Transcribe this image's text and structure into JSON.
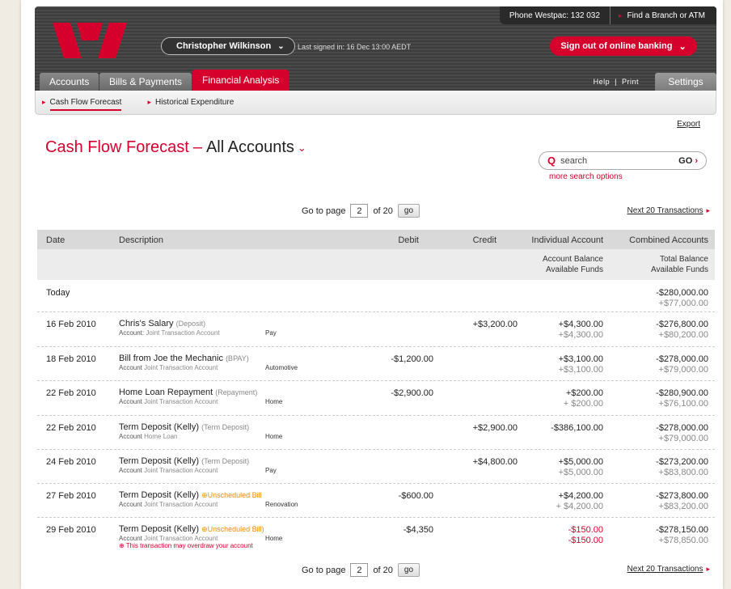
{
  "header": {
    "phone": "Phone Westpac:  132 032",
    "find_branch": "Find a Branch or ATM",
    "user_name": "Christopher Wilkinson",
    "last_signed": "Last signed in: 16 Dec 13:00 AEDT",
    "sign_out": "Sign out of online banking",
    "help": "Help",
    "print": "Print",
    "settings": "Settings"
  },
  "tabs": [
    {
      "label": "Accounts"
    },
    {
      "label": "Bills & Payments"
    },
    {
      "label": "Financial Analysis"
    }
  ],
  "subnav": [
    {
      "label": "Cash Flow Forecast"
    },
    {
      "label": "Historical Expenditure"
    }
  ],
  "export": "Export",
  "title": {
    "main": "Cash Flow Forecast",
    "dash": "–",
    "accounts": "All Accounts"
  },
  "search": {
    "placeholder": "search",
    "go": "GO",
    "more": "more search options"
  },
  "pager": {
    "goto": "Go to page",
    "page": "2",
    "of": "of 20",
    "go": "go",
    "next": "Next 20 Transactions"
  },
  "columns": {
    "date": "Date",
    "description": "Description",
    "debit": "Debit",
    "credit": "Credit",
    "individual": "Individual Account",
    "combined": "Combined Accounts",
    "individual_sub1": "Account Balance",
    "individual_sub2": "Available Funds",
    "combined_sub1": "Total Balance",
    "combined_sub2": "Available Funds"
  },
  "today": {
    "label": "Today",
    "total": "-$280,000.00",
    "avail": "+$77,000.00"
  },
  "rows": [
    {
      "date": "16 Feb 2010",
      "name": "Chris's Salary",
      "type": "(Deposit)",
      "acct_label": "Account:",
      "acct": "Joint Transaction Account",
      "cat": "Pay",
      "debit": "",
      "credit": "+$3,200.00",
      "ind1": "+$4,300.00",
      "ind2": "+$4,300.00",
      "tot1": "-$276,800.00",
      "tot2": "+$80,200.00"
    },
    {
      "date": "18 Feb 2010",
      "name": "Bill from Joe the Mechanic",
      "type": "(BPAY)",
      "acct_label": "Account",
      "acct": "Joint Transaction Account",
      "cat": "Automotive",
      "debit": "-$1,200.00",
      "credit": "",
      "ind1": "+$3,100.00",
      "ind2": "+$3,100.00",
      "tot1": "-$278,000.00",
      "tot2": "+$79,000.00"
    },
    {
      "date": "22 Feb 2010",
      "name": "Home Loan Repayment",
      "type": "(Repayment)",
      "acct_label": "Account",
      "acct": "Joint Transaction Account",
      "cat": "Home",
      "debit": "-$2,900.00",
      "credit": "",
      "ind1": "+$200.00",
      "ind2": "+ $200.00",
      "tot1": "-$280,900.00",
      "tot2": "+$76,100.00"
    },
    {
      "date": "22 Feb 2010",
      "name": "Term Deposit (Kelly)",
      "type": "(Term Deposit)",
      "acct_label": "Account",
      "acct": "Home Loan",
      "cat": "Home",
      "debit": "",
      "credit": "+$2,900.00",
      "ind1": "-$386,100.00",
      "ind2": "",
      "tot1": "-$278,000.00",
      "tot2": "+$79,000.00"
    },
    {
      "date": "24 Feb 2010",
      "name": "Term Deposit (Kelly)",
      "type": "(Term Deposit)",
      "acct_label": "Account",
      "acct": "Joint Transaction Account",
      "cat": "Pay",
      "debit": "",
      "credit": "+$4,800.00",
      "ind1": "+$5,000.00",
      "ind2": "+$5,000.00",
      "tot1": "-$273,200.00",
      "tot2": "+$83,800.00"
    },
    {
      "date": "27 Feb 2010",
      "name": "Term Deposit (Kelly)",
      "type": "Unscheduled Bill",
      "acct_label": "Account",
      "acct": "Joint Transaction Account",
      "cat": "Renovation",
      "debit": "-$600.00",
      "credit": "",
      "ind1": "+$4,200.00",
      "ind2": "+ $4,200.00",
      "tot1": "-$273,800.00",
      "tot2": "+$83,200.00"
    },
    {
      "date": "29 Feb 2010",
      "name": "Term Deposit (Kelly)",
      "type": "Unscheduled Bill)",
      "acct_label": "Account",
      "acct": "Joint Transaction Account",
      "cat": "Home",
      "warning": "This transaction may overdraw your account",
      "debit": "-$4,350",
      "credit": "",
      "ind1": "-$150.00",
      "ind2": "-$150.00",
      "tot1": "-$278,150.00",
      "tot2": "+$78,850.00"
    }
  ],
  "colors": {
    "brand_red": "#d5002b",
    "unscheduled_orange": "#f08a00",
    "header_dark": "#3d3d3d"
  }
}
